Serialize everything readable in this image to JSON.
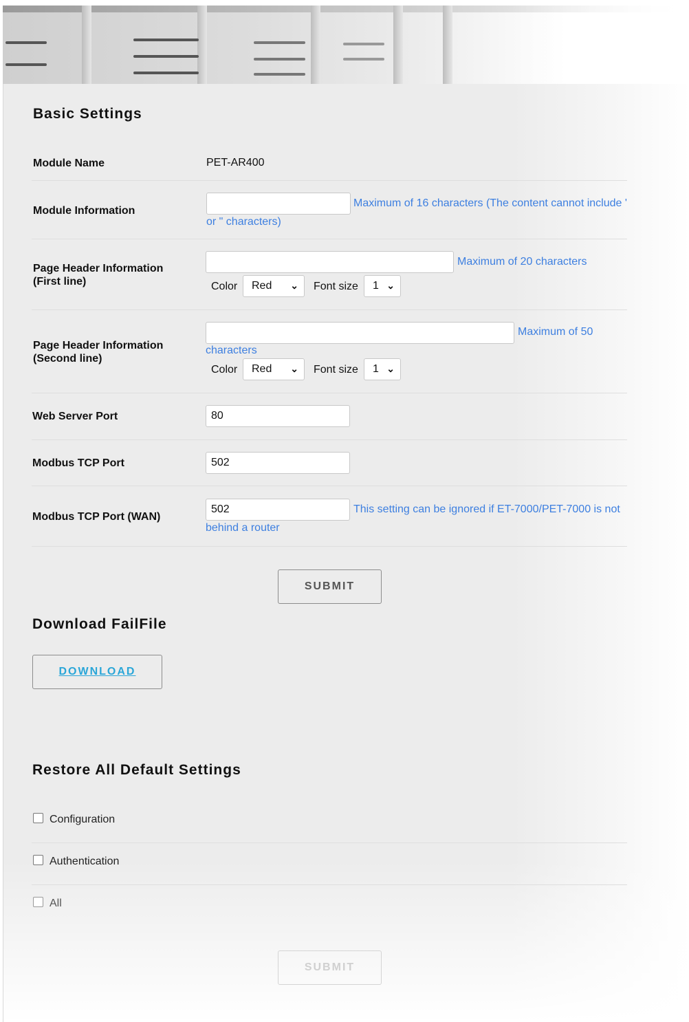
{
  "basic_settings": {
    "title": "Basic Settings",
    "module_name": {
      "label": "Module Name",
      "value": "PET-AR400"
    },
    "module_information": {
      "label": "Module Information",
      "value": "",
      "hint": "Maximum of 16 characters (The content cannot include ' or \" characters)"
    },
    "header_first": {
      "label_1": "Page Header Information",
      "label_2": "(First line)",
      "value": "",
      "hint": "Maximum of 20 characters",
      "color_label": "Color",
      "color_value": "Red",
      "font_size_label": "Font size",
      "font_size_value": "1"
    },
    "header_second": {
      "label_1": "Page Header Information",
      "label_2": "(Second line)",
      "value": "",
      "hint": "Maximum of 50 characters",
      "color_label": "Color",
      "color_value": "Red",
      "font_size_label": "Font size",
      "font_size_value": "1"
    },
    "web_server_port": {
      "label": "Web Server Port",
      "value": "80"
    },
    "modbus_tcp_port": {
      "label": "Modbus TCP Port",
      "value": "502"
    },
    "modbus_tcp_port_wan": {
      "label": "Modbus TCP Port (WAN)",
      "value": "502",
      "hint": "This setting can be ignored if ET-7000/PET-7000 is not behind a router"
    },
    "submit_label": "SUBMIT"
  },
  "download_failfile": {
    "title": "Download FailFile",
    "button_label": "DOWNLOAD"
  },
  "restore_defaults": {
    "title": "Restore All Default Settings",
    "options": [
      {
        "label": "Configuration",
        "checked": false
      },
      {
        "label": "Authentication",
        "checked": false
      },
      {
        "label": "All",
        "checked": false
      }
    ],
    "submit_label": "SUBMIT"
  },
  "colors": {
    "hint_text": "#3d7fe0",
    "download_link": "#2aa6d8",
    "background": "#ececec"
  }
}
